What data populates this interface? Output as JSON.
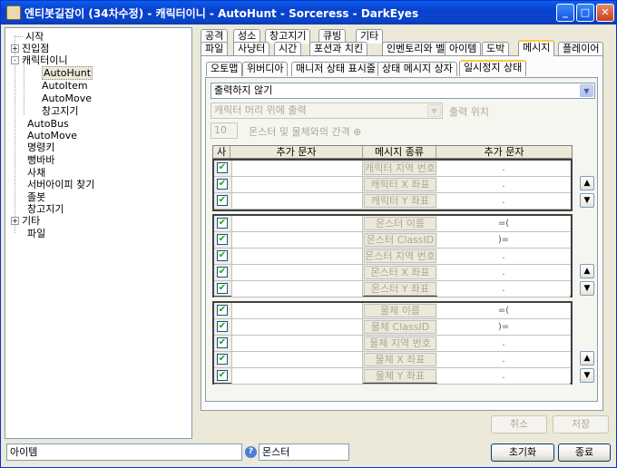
{
  "window": {
    "title": "엔티봇길잡이 (34차수정) - 캐릭터이니 - AutoHunt - Sorceress - DarkEyes",
    "minimize_glyph": "_",
    "maximize_glyph": "□",
    "close_glyph": "✕"
  },
  "tree": {
    "items": [
      {
        "label": "시작"
      },
      {
        "label": "진입점"
      },
      {
        "label": "캐릭터이니"
      },
      {
        "label": "AutoHunt"
      },
      {
        "label": "AutoItem"
      },
      {
        "label": "AutoMove"
      },
      {
        "label": "창고지기"
      },
      {
        "label": "AutoBus"
      },
      {
        "label": "AutoMove"
      },
      {
        "label": "명령키"
      },
      {
        "label": "뻥바바"
      },
      {
        "label": "사채"
      },
      {
        "label": "서버아이피 찾기"
      },
      {
        "label": "졸봇"
      },
      {
        "label": "창고지기"
      },
      {
        "label": "기타"
      },
      {
        "label": "파일"
      }
    ],
    "plus": "+",
    "minus": "-"
  },
  "tabs_row1": [
    "공격",
    "성소",
    "창고지기",
    "큐빙",
    "기타"
  ],
  "tabs_row2": [
    "파일",
    "사냥터",
    "시간",
    "포션과 치킨",
    "인벤토리와 벨트",
    "아이템",
    "도박",
    "메시지",
    "플레이어"
  ],
  "subtabs": [
    "오토맵",
    "위버디아",
    "매니저 상태 표시줄",
    "상태 메시지 상자",
    "일시정지 상태"
  ],
  "output_combo": {
    "value": "출력하지 않기",
    "arrow": "▼"
  },
  "position_combo": {
    "value": "캐릭터 머리 위에 출력",
    "arrow": "▼"
  },
  "position_label": "출력 위치",
  "spin": {
    "value": "10",
    "label": "몬스터 및 물체와의 간격 ⊕"
  },
  "grid_headers": [
    "사",
    "추가 문자",
    "메시지 종류",
    "추가 문자"
  ],
  "groups": [
    {
      "rows": [
        {
          "check": "✔",
          "kind": "캐릭터 지역 번호",
          "suffix": "."
        },
        {
          "check": "✔",
          "kind": "캐릭터 X 좌표",
          "suffix": "."
        },
        {
          "check": "✔",
          "kind": "캐릭터 Y 좌표",
          "suffix": "."
        }
      ]
    },
    {
      "rows": [
        {
          "check": "✔",
          "kind": "몬스터 이름",
          "suffix": "=("
        },
        {
          "check": "✔",
          "kind": "몬스터 ClassID",
          "suffix": ")="
        },
        {
          "check": "✔",
          "kind": "몬스터 지역 번호",
          "suffix": "."
        },
        {
          "check": "✔",
          "kind": "몬스터 X 좌표",
          "suffix": "."
        },
        {
          "check": "✔",
          "kind": "몬스터 Y 좌표",
          "suffix": "."
        }
      ]
    },
    {
      "rows": [
        {
          "check": "✔",
          "kind": "물체 이름",
          "suffix": "=("
        },
        {
          "check": "✔",
          "kind": "물체 ClassID",
          "suffix": ")="
        },
        {
          "check": "✔",
          "kind": "물체 지역 번호",
          "suffix": "."
        },
        {
          "check": "✔",
          "kind": "물체 X 좌표",
          "suffix": "."
        },
        {
          "check": "✔",
          "kind": "물체 Y 좌표",
          "suffix": "."
        }
      ]
    }
  ],
  "arrows": {
    "up": "▲",
    "down": "▼"
  },
  "buttons": {
    "cancel": "취소",
    "save": "저장",
    "reset": "초기화",
    "exit": "종료"
  },
  "status": {
    "left": "아이템",
    "help": "?",
    "right": "몬스터"
  }
}
